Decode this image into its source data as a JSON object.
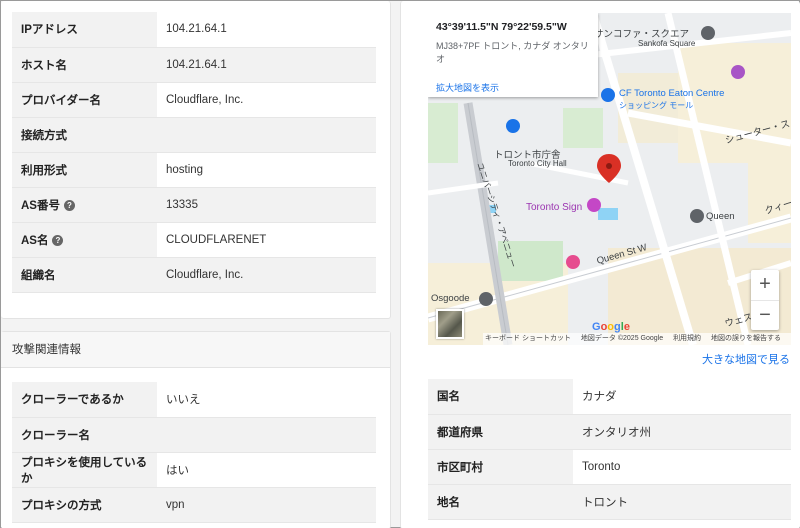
{
  "host_info": {
    "rows": [
      {
        "label": "IPアドレス",
        "value": "104.21.64.1",
        "help": false
      },
      {
        "label": "ホスト名",
        "value": "104.21.64.1",
        "help": false
      },
      {
        "label": "プロバイダー名",
        "value": "Cloudflare, Inc.",
        "help": false
      },
      {
        "label": "接続方式",
        "value": "",
        "help": false
      },
      {
        "label": "利用形式",
        "value": "hosting",
        "help": false
      },
      {
        "label": "AS番号",
        "value": "13335",
        "help": true
      },
      {
        "label": "AS名",
        "value": "CLOUDFLARENET",
        "help": true
      },
      {
        "label": "組織名",
        "value": "Cloudflare, Inc.",
        "help": false
      }
    ]
  },
  "attack": {
    "heading": "攻撃関連情報",
    "rows": [
      {
        "label": "クローラーであるか",
        "value": "いいえ"
      },
      {
        "label": "クローラー名",
        "value": ""
      },
      {
        "label": "プロキシを使用しているか",
        "value": "はい"
      },
      {
        "label": "プロキシの方式",
        "value": "vpn"
      }
    ]
  },
  "map": {
    "popup": {
      "coord": "43°39'11.5\"N 79°22'59.5\"W",
      "address": "MJ38+7PF トロント, カナダ オンタリオ",
      "enlarge_link": "拡大地図を表示"
    },
    "labels": {
      "sankofa": "サンコファ・スクエア",
      "sankofa_en": "Sankofa Square",
      "eaton": "CF Toronto Eaton Centre",
      "eaton_sub": "ショッピング モール",
      "shuter": "シューター・ス",
      "cityhall": "トロント市庁舎",
      "cityhall_en": "Toronto City Hall",
      "sign": "Toronto Sign",
      "queen": "Queen",
      "queen_st": "Queen St W",
      "osgoode": "Osgoode",
      "university": "ユニバーシティ・アベニュー",
      "west": "ウェスト",
      "queen_right": "クィー",
      "google": "Google"
    },
    "footer": {
      "shortcuts": "キーボード ショートカット",
      "data": "地図データ ©2025 Google",
      "terms": "利用規約",
      "report": "地図の誤りを報告する"
    },
    "zoom_in": "+",
    "zoom_out": "−",
    "big_map_link": "大きな地図で見る",
    "pin_color": "#d93025"
  },
  "geo": {
    "rows": [
      {
        "label": "国名",
        "value": "カナダ"
      },
      {
        "label": "都道府県",
        "value": "オンタリオ州"
      },
      {
        "label": "市区町村",
        "value": "Toronto"
      },
      {
        "label": "地名",
        "value": "トロント"
      }
    ]
  }
}
